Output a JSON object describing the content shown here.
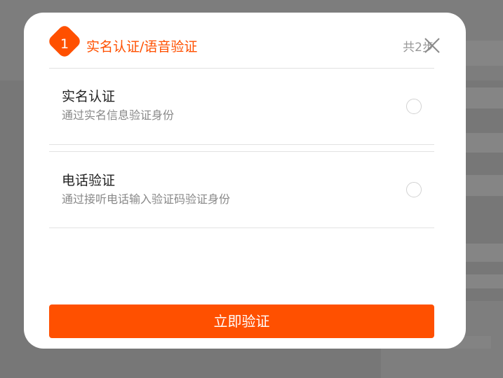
{
  "header": {
    "step_number": "1",
    "step_title": "实名认证/语音验证",
    "step_total": "共2步"
  },
  "options": [
    {
      "title": "实名认证",
      "description": "通过实名信息验证身份",
      "selected": false
    },
    {
      "title": "电话验证",
      "description": "通过接听电话输入验证码验证身份",
      "selected": false
    }
  ],
  "submit_label": "立即验证",
  "colors": {
    "accent": "#ff5000",
    "overlay": "#7a7a7a"
  },
  "icons": {
    "close": "close-icon",
    "step": "diamond-badge-icon"
  }
}
